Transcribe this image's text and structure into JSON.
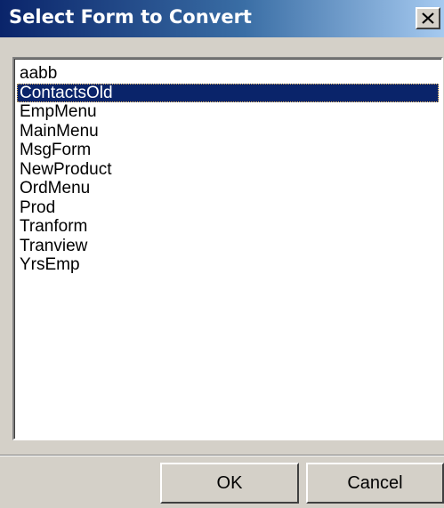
{
  "window": {
    "title": "Select Form to Convert"
  },
  "list": {
    "items": [
      "aabb",
      "ContactsOld",
      "EmpMenu",
      "MainMenu",
      "MsgForm",
      "NewProduct",
      "OrdMenu",
      "Prod",
      "Tranform",
      "Tranview",
      "YrsEmp"
    ],
    "selected_index": 1
  },
  "buttons": {
    "ok_label": "OK",
    "cancel_label": "Cancel"
  },
  "icons": {
    "close": "close-icon"
  },
  "colors": {
    "title_start": "#0a246a",
    "title_end": "#a6caf0",
    "selection": "#0a246a",
    "face": "#d4d0c8"
  }
}
